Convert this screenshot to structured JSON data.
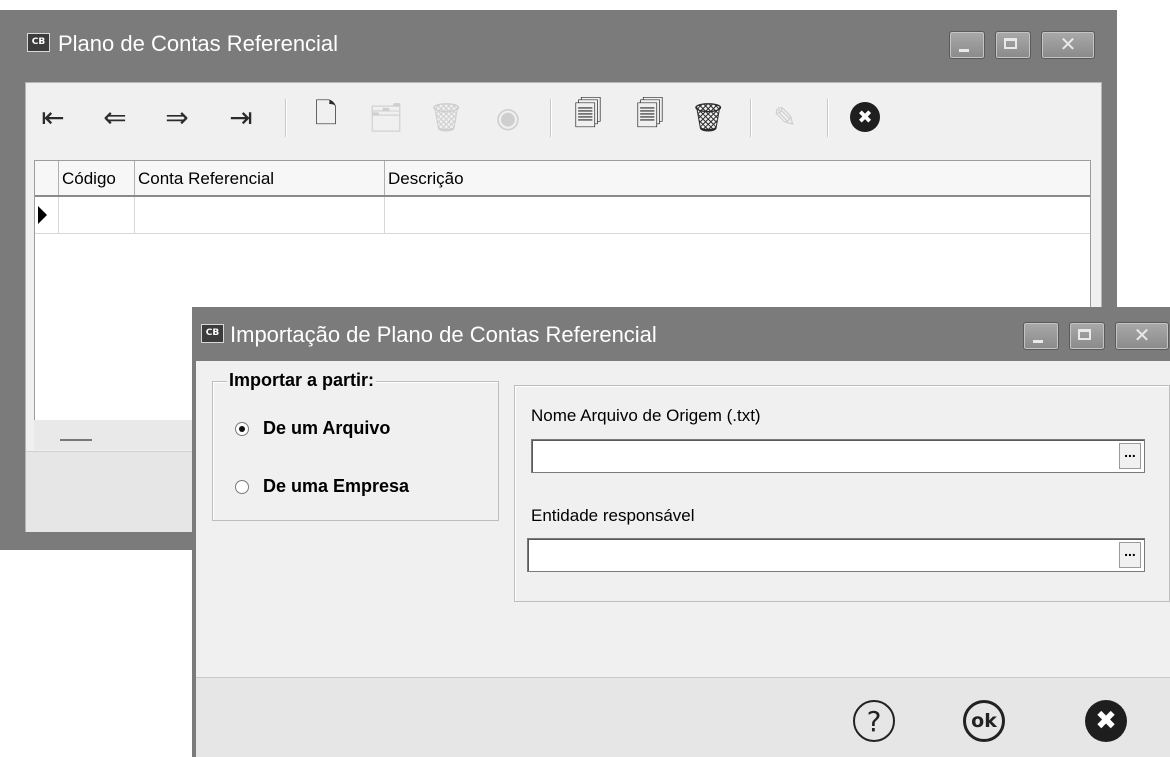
{
  "back_window": {
    "icon_text": "CB",
    "title": "Plano de Contas Referencial",
    "caption_buttons": {
      "minimize": "minimize-icon",
      "maximize": "maximize-icon",
      "close": "close-icon"
    },
    "toolbar": [
      {
        "name": "first-record-icon",
        "glyph": "⇤",
        "enabled": true
      },
      {
        "name": "prev-record-icon",
        "glyph": "⇐",
        "enabled": true
      },
      {
        "name": "next-record-icon",
        "glyph": "⇒",
        "enabled": true
      },
      {
        "name": "last-record-icon",
        "glyph": "⇥",
        "enabled": true
      },
      {
        "name": "new-document-icon",
        "glyph": "🗋",
        "enabled": true
      },
      {
        "name": "edit-folder-icon",
        "glyph": "🗂",
        "enabled": false
      },
      {
        "name": "delete-trash-icon",
        "glyph": "🗑",
        "enabled": false
      },
      {
        "name": "view-eye-icon",
        "glyph": "◉",
        "enabled": false
      },
      {
        "name": "copy-icon",
        "glyph": "🗐",
        "enabled": true
      },
      {
        "name": "paste-icon",
        "glyph": "🗐",
        "enabled": true
      },
      {
        "name": "delete-all-icon",
        "glyph": "🗑",
        "enabled": true
      },
      {
        "name": "edit-note-icon",
        "glyph": "✎",
        "enabled": false
      },
      {
        "name": "close-circle-icon",
        "glyph": "✖",
        "enabled": true
      }
    ],
    "grid": {
      "columns": [
        "Código",
        "Conta Referencial",
        "Descrição"
      ]
    }
  },
  "dialog": {
    "icon_text": "CB",
    "title": "Importação de Plano de Contas Referencial",
    "import_group": {
      "legend": "Importar a partir:",
      "options": [
        {
          "label": "De um Arquivo",
          "selected": true
        },
        {
          "label": "De uma Empresa",
          "selected": false
        }
      ]
    },
    "source_file": {
      "label": "Nome Arquivo de Origem (.txt)",
      "value": "",
      "button": "..."
    },
    "entity": {
      "label": "Entidade responsável",
      "value": "",
      "button": "..."
    },
    "footer": {
      "help": "?",
      "ok": "ok",
      "cancel": "✖"
    }
  }
}
